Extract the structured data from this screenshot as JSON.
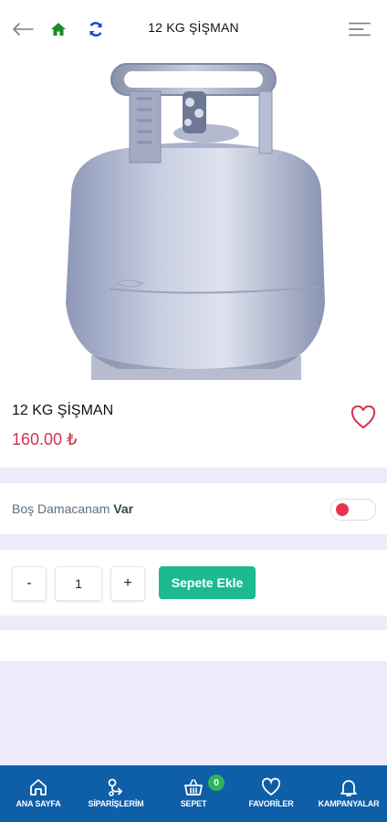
{
  "header": {
    "title": "12 KG ŞİŞMAN",
    "back_icon": "arrow-left-icon",
    "home_icon": "home-icon",
    "refresh_icon": "refresh-icon",
    "menu_icon": "menu-icon"
  },
  "product": {
    "name": "12 KG ŞİŞMAN",
    "price": "160.00 ₺",
    "image": "gas-cylinder-image"
  },
  "option": {
    "label": "Boş Damacanam",
    "value": "Var",
    "toggle_on": false
  },
  "quantity": {
    "minus": "-",
    "value": "1",
    "plus": "+",
    "add_to_cart": "Sepete Ekle"
  },
  "bottom_nav": {
    "items": [
      {
        "label": "ANA SAYFA",
        "icon": "home-icon"
      },
      {
        "label": "SİPARİŞLERİM",
        "icon": "orders-icon"
      },
      {
        "label": "SEPET",
        "icon": "basket-icon",
        "badge": "0"
      },
      {
        "label": "FAVORİLER",
        "icon": "heart-icon"
      },
      {
        "label": "KAMPANYALAR",
        "icon": "bell-icon"
      }
    ]
  },
  "colors": {
    "accent_green": "#1db990",
    "price_red": "#d6304f",
    "nav_blue": "#0e5ea8",
    "background": "#ebebfa"
  }
}
